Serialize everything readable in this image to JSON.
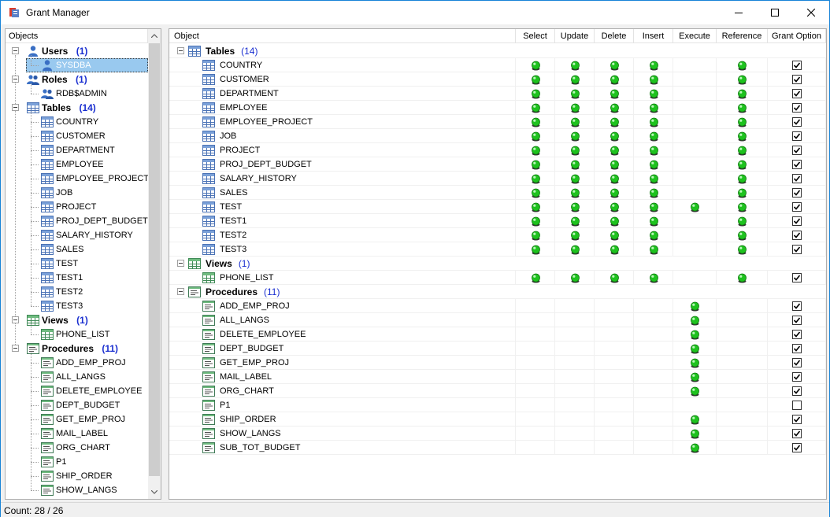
{
  "window": {
    "title": "Grant Manager"
  },
  "left": {
    "header": "Objects",
    "users": {
      "label": "Users",
      "count": "(1)",
      "items": [
        "SYSDBA"
      ]
    },
    "roles": {
      "label": "Roles",
      "count": "(1)",
      "items": [
        "RDB$ADMIN"
      ]
    },
    "tables": {
      "label": "Tables",
      "count": "(14)",
      "items": [
        "COUNTRY",
        "CUSTOMER",
        "DEPARTMENT",
        "EMPLOYEE",
        "EMPLOYEE_PROJECT",
        "JOB",
        "PROJECT",
        "PROJ_DEPT_BUDGET",
        "SALARY_HISTORY",
        "SALES",
        "TEST",
        "TEST1",
        "TEST2",
        "TEST3"
      ]
    },
    "views": {
      "label": "Views",
      "count": "(1)",
      "items": [
        "PHONE_LIST"
      ]
    },
    "procedures": {
      "label": "Procedures",
      "count": "(11)",
      "items": [
        "ADD_EMP_PROJ",
        "ALL_LANGS",
        "DELETE_EMPLOYEE",
        "DEPT_BUDGET",
        "GET_EMP_PROJ",
        "MAIL_LABEL",
        "ORG_CHART",
        "P1",
        "SHIP_ORDER",
        "SHOW_LANGS"
      ]
    }
  },
  "grid": {
    "columns": [
      "Object",
      "Select",
      "Update",
      "Delete",
      "Insert",
      "Execute",
      "Reference",
      "Grant Option"
    ],
    "groups": [
      {
        "label": "Tables",
        "count": "(14)",
        "icon": "table-icon",
        "rows": [
          {
            "name": "COUNTRY",
            "perms": [
              1,
              1,
              1,
              1,
              0,
              1,
              1
            ]
          },
          {
            "name": "CUSTOMER",
            "perms": [
              1,
              1,
              1,
              1,
              0,
              1,
              1
            ]
          },
          {
            "name": "DEPARTMENT",
            "perms": [
              1,
              1,
              1,
              1,
              0,
              1,
              1
            ]
          },
          {
            "name": "EMPLOYEE",
            "perms": [
              1,
              1,
              1,
              1,
              0,
              1,
              1
            ]
          },
          {
            "name": "EMPLOYEE_PROJECT",
            "perms": [
              1,
              1,
              1,
              1,
              0,
              1,
              1
            ]
          },
          {
            "name": "JOB",
            "perms": [
              1,
              1,
              1,
              1,
              0,
              1,
              1
            ]
          },
          {
            "name": "PROJECT",
            "perms": [
              1,
              1,
              1,
              1,
              0,
              1,
              1
            ]
          },
          {
            "name": "PROJ_DEPT_BUDGET",
            "perms": [
              1,
              1,
              1,
              1,
              0,
              1,
              1
            ]
          },
          {
            "name": "SALARY_HISTORY",
            "perms": [
              1,
              1,
              1,
              1,
              0,
              1,
              1
            ]
          },
          {
            "name": "SALES",
            "perms": [
              1,
              1,
              1,
              1,
              0,
              1,
              1
            ]
          },
          {
            "name": "TEST",
            "perms": [
              1,
              1,
              1,
              1,
              1,
              1,
              1
            ]
          },
          {
            "name": "TEST1",
            "perms": [
              1,
              1,
              1,
              1,
              0,
              1,
              1
            ]
          },
          {
            "name": "TEST2",
            "perms": [
              1,
              1,
              1,
              1,
              0,
              1,
              1
            ]
          },
          {
            "name": "TEST3",
            "perms": [
              1,
              1,
              1,
              1,
              0,
              1,
              1
            ]
          }
        ]
      },
      {
        "label": "Views",
        "count": "(1)",
        "icon": "view-icon",
        "rows": [
          {
            "name": "PHONE_LIST",
            "perms": [
              1,
              1,
              1,
              1,
              0,
              1,
              1
            ]
          }
        ]
      },
      {
        "label": "Procedures",
        "count": "(11)",
        "icon": "procedure-icon",
        "rows": [
          {
            "name": "ADD_EMP_PROJ",
            "perms": [
              0,
              0,
              0,
              0,
              1,
              0,
              1
            ]
          },
          {
            "name": "ALL_LANGS",
            "perms": [
              0,
              0,
              0,
              0,
              1,
              0,
              1
            ]
          },
          {
            "name": "DELETE_EMPLOYEE",
            "perms": [
              0,
              0,
              0,
              0,
              1,
              0,
              1
            ]
          },
          {
            "name": "DEPT_BUDGET",
            "perms": [
              0,
              0,
              0,
              0,
              1,
              0,
              1
            ]
          },
          {
            "name": "GET_EMP_PROJ",
            "perms": [
              0,
              0,
              0,
              0,
              1,
              0,
              1
            ]
          },
          {
            "name": "MAIL_LABEL",
            "perms": [
              0,
              0,
              0,
              0,
              1,
              0,
              1
            ]
          },
          {
            "name": "ORG_CHART",
            "perms": [
              0,
              0,
              0,
              0,
              1,
              0,
              1
            ]
          },
          {
            "name": "P1",
            "perms": [
              0,
              0,
              0,
              0,
              0,
              0,
              0
            ]
          },
          {
            "name": "SHIP_ORDER",
            "perms": [
              0,
              0,
              0,
              0,
              1,
              0,
              1
            ]
          },
          {
            "name": "SHOW_LANGS",
            "perms": [
              0,
              0,
              0,
              0,
              1,
              0,
              1
            ]
          },
          {
            "name": "SUB_TOT_BUDGET",
            "perms": [
              0,
              0,
              0,
              0,
              1,
              0,
              1
            ]
          }
        ]
      }
    ]
  },
  "status": {
    "text": "Count: 28 / 26"
  },
  "colors": {
    "accent": "#0078d7",
    "grant_green": "#1ec21e",
    "count_blue": "#1a2fd0"
  }
}
